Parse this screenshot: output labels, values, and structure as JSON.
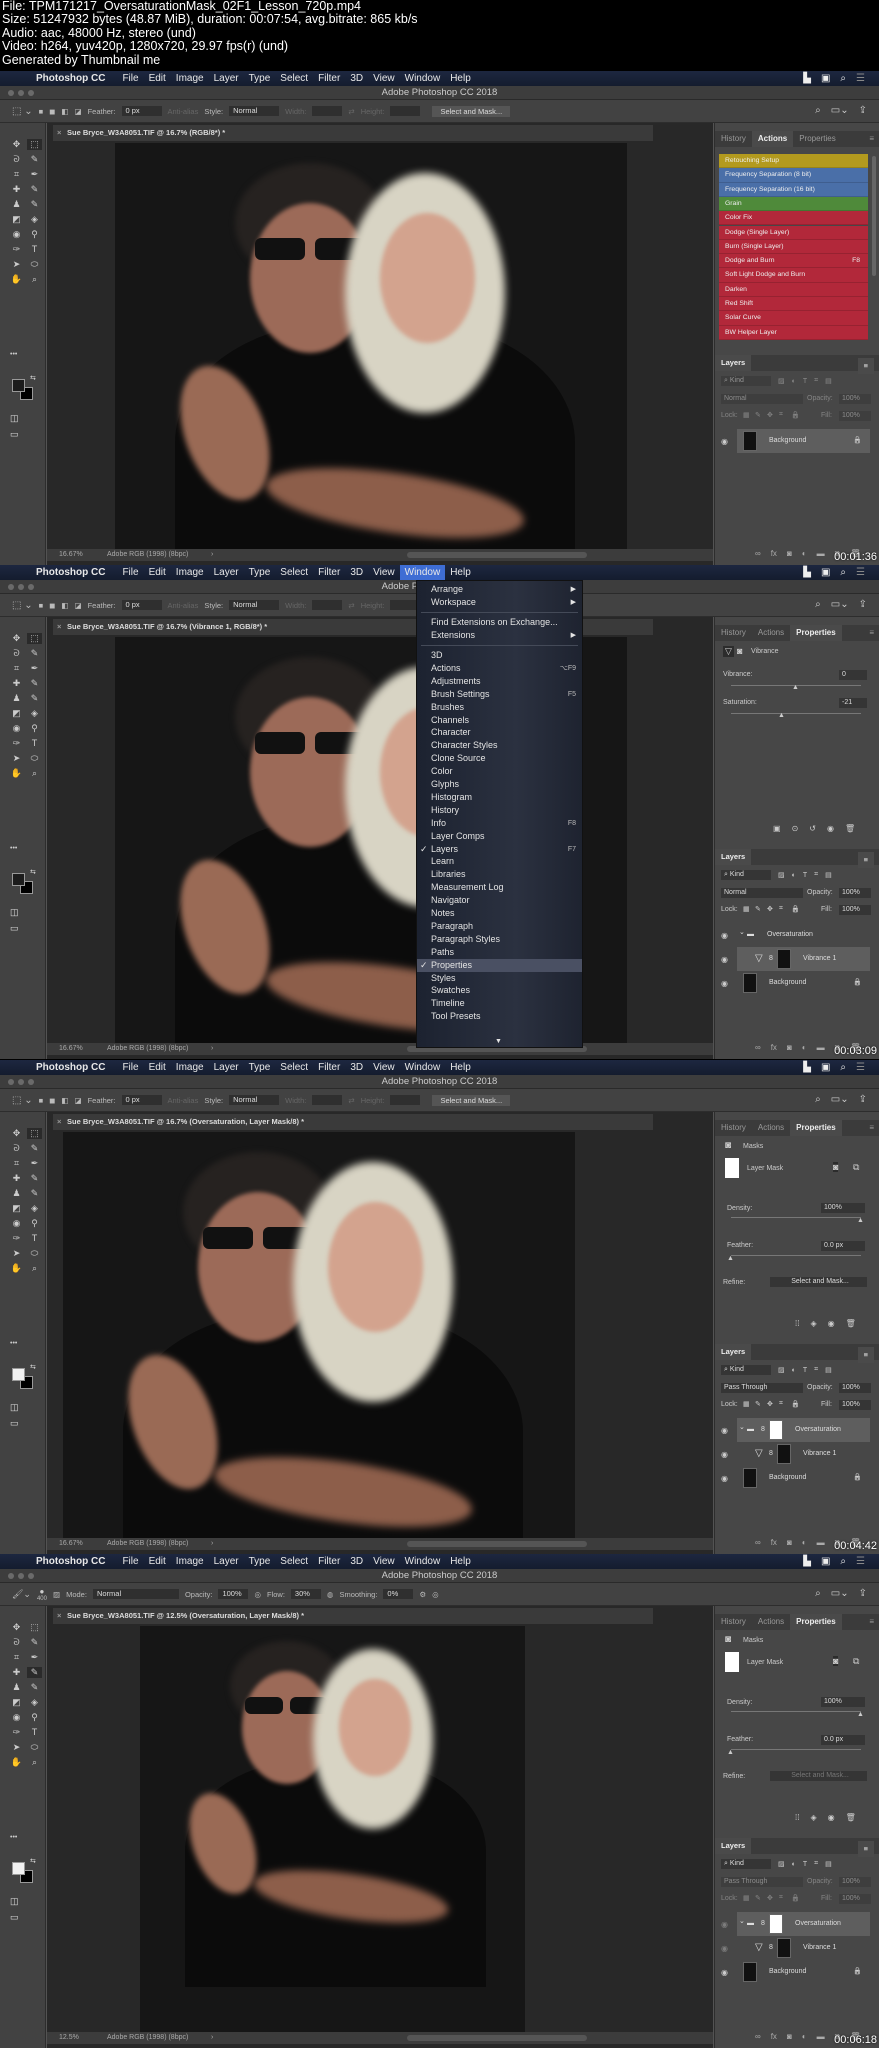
{
  "header": {
    "lines": [
      "File: TPM171217_OversaturationMask_02F1_Lesson_720p.mp4",
      "Size: 51247932 bytes (48.87 MiB), duration: 00:07:54, avg.bitrate: 865 kb/s",
      "Audio: aac, 48000 Hz, stereo (und)",
      "Video: h264, yuv420p, 1280x720, 29.97 fps(r) (und)",
      "Generated by Thumbnail me"
    ]
  },
  "app": {
    "name": "Photoshop CC",
    "menus": [
      "File",
      "Edit",
      "Image",
      "Layer",
      "Type",
      "Select",
      "Filter",
      "3D",
      "View",
      "Window",
      "Help"
    ],
    "window_title": "Adobe Photoshop CC 2018",
    "panel_tabs": [
      "History",
      "Actions",
      "Properties"
    ],
    "layers_title": "Layers",
    "status_profile": "Adobe RGB (1998) (8bpc)"
  },
  "marquee_options": {
    "feather_label": "Feather:",
    "feather_value": "0 px",
    "anti_alias": "Anti-alias",
    "style_label": "Style:",
    "style_value": "Normal",
    "width_label": "Width:",
    "height_label": "Height:",
    "select_mask": "Select and Mask..."
  },
  "brush_options": {
    "size": "400",
    "mode_label": "Mode:",
    "mode_value": "Normal",
    "opacity_label": "Opacity:",
    "opacity_value": "100%",
    "flow_label": "Flow:",
    "flow_value": "30%",
    "smoothing_label": "Smoothing:",
    "smoothing_value": "0%"
  },
  "actions": [
    {
      "label": "Retouching Setup",
      "color": "#b39a1e"
    },
    {
      "label": "Frequency Separation (8 bit)",
      "color": "#4a6fa8"
    },
    {
      "label": "Frequency Separation (16 bit)",
      "color": "#4a6fa8"
    },
    {
      "label": "Grain",
      "color": "#4f8a3a"
    },
    {
      "label": "Color Fix",
      "color": "#b2283a"
    },
    {
      "label": "Dodge (Single Layer)",
      "color": "#b2283a"
    },
    {
      "label": "Burn (Single Layer)",
      "color": "#b2283a"
    },
    {
      "label": "Dodge and Burn",
      "color": "#b2283a",
      "shortcut": "F8"
    },
    {
      "label": "Soft Light Dodge and Burn",
      "color": "#b2283a"
    },
    {
      "label": "Darken",
      "color": "#b2283a"
    },
    {
      "label": "Red Shift",
      "color": "#b2283a"
    },
    {
      "label": "Solar Curve",
      "color": "#b2283a"
    },
    {
      "label": "BW Helper Layer",
      "color": "#b2283a"
    }
  ],
  "vibrance_props": {
    "title": "Vibrance",
    "vibrance_label": "Vibrance:",
    "vibrance_value": "0",
    "saturation_label": "Saturation:",
    "saturation_value": "-21"
  },
  "mask_props": {
    "title": "Masks",
    "layer_mask": "Layer Mask",
    "density_label": "Density:",
    "density_value": "100%",
    "feather_label": "Feather:",
    "feather_value": "0.0 px",
    "refine_label": "Refine:",
    "select_mask": "Select and Mask..."
  },
  "layers_controls": {
    "kind": "Kind",
    "opacity_label": "Opacity:",
    "opacity_value": "100%",
    "lock_label": "Lock:",
    "fill_label": "Fill:",
    "fill_value": "100%"
  },
  "window_menu": {
    "items": [
      {
        "label": "Arrange",
        "sub": true
      },
      {
        "label": "Workspace",
        "sub": true
      },
      {
        "sep": true
      },
      {
        "label": "Find Extensions on Exchange..."
      },
      {
        "label": "Extensions",
        "sub": true
      },
      {
        "sep": true
      },
      {
        "label": "3D"
      },
      {
        "label": "Actions",
        "shortcut": "⌥F9"
      },
      {
        "label": "Adjustments"
      },
      {
        "label": "Brush Settings",
        "shortcut": "F5"
      },
      {
        "label": "Brushes"
      },
      {
        "label": "Channels"
      },
      {
        "label": "Character"
      },
      {
        "label": "Character Styles"
      },
      {
        "label": "Clone Source"
      },
      {
        "label": "Color"
      },
      {
        "label": "Glyphs"
      },
      {
        "label": "Histogram"
      },
      {
        "label": "History"
      },
      {
        "label": "Info",
        "shortcut": "F8"
      },
      {
        "label": "Layer Comps"
      },
      {
        "label": "Layers",
        "checked": true,
        "shortcut": "F7"
      },
      {
        "label": "Learn"
      },
      {
        "label": "Libraries"
      },
      {
        "label": "Measurement Log"
      },
      {
        "label": "Navigator"
      },
      {
        "label": "Notes"
      },
      {
        "label": "Paragraph"
      },
      {
        "label": "Paragraph Styles"
      },
      {
        "label": "Paths"
      },
      {
        "label": "Properties",
        "checked": true,
        "selected": true
      },
      {
        "label": "Styles"
      },
      {
        "label": "Swatches"
      },
      {
        "label": "Timeline"
      },
      {
        "label": "Tool Presets"
      }
    ]
  },
  "frames": [
    {
      "tool": "marquee",
      "doc_tab": "Sue Bryce_W3A8051.TIF @ 16.7% (RGB/8*) *",
      "zoom": "16.67%",
      "timestamp": "00:01:36",
      "panel": "actions",
      "active_tab": 1,
      "blend": "Normal",
      "layers_dim": true,
      "layers": [
        {
          "name": "Background",
          "type": "bg",
          "selected": true
        }
      ]
    },
    {
      "tool": "marquee",
      "active_menu": "Window",
      "doc_tab": "Sue Bryce_W3A8051.TIF @ 16.7% (Vibrance 1, RGB/8*) *",
      "zoom": "16.67%",
      "timestamp": "00:03:09",
      "panel": "vibrance",
      "active_tab": 2,
      "blend": "Normal",
      "layers": [
        {
          "name": "Oversaturation",
          "type": "group"
        },
        {
          "name": "Vibrance 1",
          "type": "adj",
          "selected": true
        },
        {
          "name": "Background",
          "type": "bg"
        }
      ]
    },
    {
      "tool": "marquee",
      "doc_tab": "Sue Bryce_W3A8051.TIF @ 16.7% (Oversaturation, Layer Mask/8) *",
      "zoom": "16.67%",
      "timestamp": "00:04:42",
      "panel": "masks",
      "active_tab": 2,
      "blend": "Pass Through",
      "layers": [
        {
          "name": "Oversaturation",
          "type": "group-mask",
          "selected": true
        },
        {
          "name": "Vibrance 1",
          "type": "adj"
        },
        {
          "name": "Background",
          "type": "bg"
        }
      ]
    },
    {
      "tool": "brush",
      "doc_tab": "Sue Bryce_W3A8051.TIF @ 12.5% (Oversaturation, Layer Mask/8) *",
      "zoom": "12.5%",
      "timestamp": "00:06:18",
      "panel": "masks",
      "active_tab": 2,
      "blend": "Pass Through",
      "layers_dim": true,
      "layers": [
        {
          "name": "Oversaturation",
          "type": "group-mask",
          "selected": true
        },
        {
          "name": "Vibrance 1",
          "type": "adj"
        },
        {
          "name": "Background",
          "type": "bg"
        }
      ]
    }
  ]
}
